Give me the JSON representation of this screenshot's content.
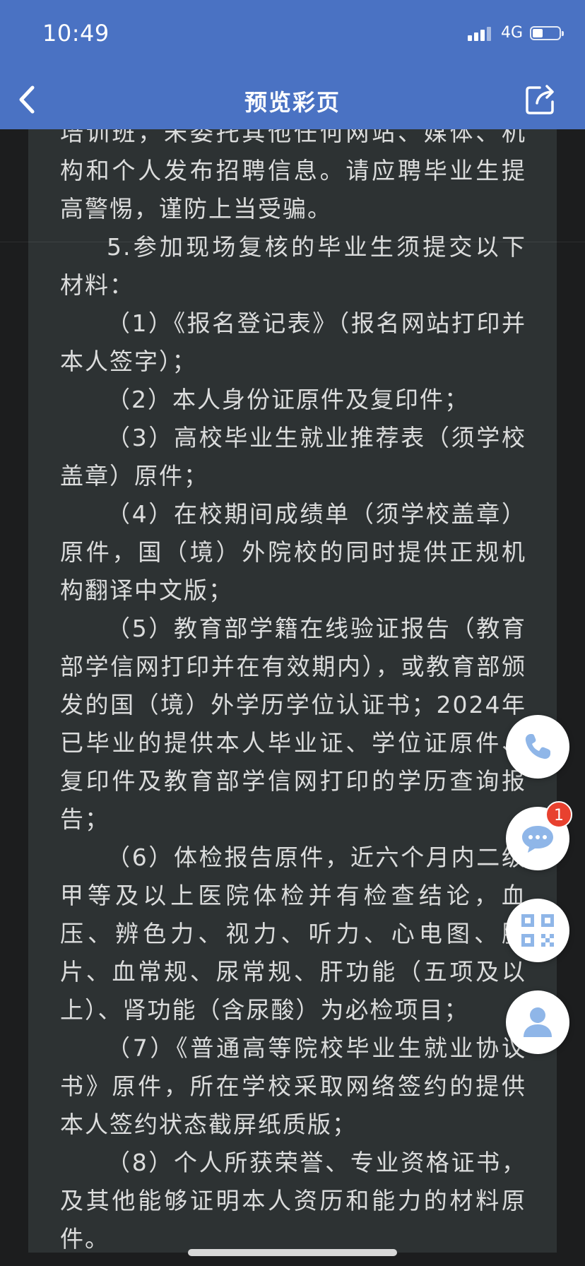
{
  "status_bar": {
    "time": "10:49",
    "network": "4G"
  },
  "nav": {
    "title": "预览彩页"
  },
  "document": {
    "paragraphs": [
      {
        "text": "培训班，未委托其他任何网站、媒体、机构和个人发布招聘信息。请应聘毕业生提高警惕，谨防上当受骗。",
        "indent": false
      },
      {
        "text": "5.参加现场复核的毕业生须提交以下材料：",
        "indent": true
      },
      {
        "text": "（1）《报名登记表》（报名网站打印并本人签字）；",
        "indent": true
      },
      {
        "text": "（2）本人身份证原件及复印件；",
        "indent": true
      },
      {
        "text": "（3）高校毕业生就业推荐表（须学校盖章）原件；",
        "indent": true
      },
      {
        "text": "（4）在校期间成绩单（须学校盖章）原件，国（境）外院校的同时提供正规机构翻译中文版；",
        "indent": true
      },
      {
        "text": "（5）教育部学籍在线验证报告（教育部学信网打印并在有效期内），或教育部颁发的国（境）外学历学位认证书；2024年已毕业的提供本人毕业证、学位证原件、复印件及教育部学信网打印的学历查询报告；",
        "indent": true
      },
      {
        "text": "（6）体检报告原件，近六个月内二级甲等及以上医院体检并有检查结论，血压、辨色力、视力、听力、心电图、胸片、血常规、尿常规、肝功能（五项及以上）、肾功能（含尿酸）为必检项目；",
        "indent": true
      },
      {
        "text": "（7）《普通高等院校毕业生就业协议书》原件，所在学校采取网络签约的提供本人签约状态截屏纸质版；",
        "indent": true
      },
      {
        "text": "（8）个人所获荣誉、专业资格证书，及其他能够证明本人资历和能力的材料原件。",
        "indent": true
      }
    ]
  },
  "floating_actions": {
    "message_badge": "1",
    "icons": [
      "phone-icon",
      "chat-icon",
      "qr-code-icon",
      "user-icon"
    ]
  },
  "colors": {
    "header": "#4a72c3",
    "page_bg": "#2d3233",
    "text": "#dbdcdc",
    "accent_icon": "#8fb6e8",
    "badge": "#e8412f"
  }
}
